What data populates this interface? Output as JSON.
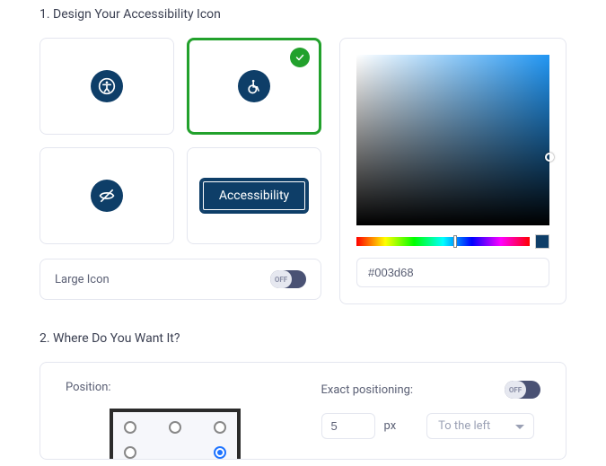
{
  "section1": {
    "title": "1. Design Your Accessibility Icon",
    "options": {
      "opt3_label": "Accessibility"
    },
    "large_icon_label": "Large Icon",
    "large_icon_toggle": "OFF",
    "color": {
      "hex": "#003d68"
    }
  },
  "section2": {
    "title": "2. Where Do You Want It?",
    "position_label": "Position:",
    "exact_label": "Exact positioning:",
    "exact_toggle": "OFF",
    "offset_x": "5",
    "unit_x": "px",
    "direction_x": "To the left"
  }
}
